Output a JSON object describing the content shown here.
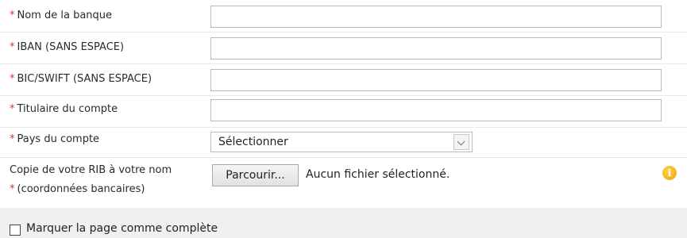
{
  "form": {
    "required_mark": "*",
    "fields": [
      {
        "label": "Nom de la banque",
        "value": ""
      },
      {
        "label": "IBAN (SANS ESPACE)",
        "value": ""
      },
      {
        "label": "BIC/SWIFT (SANS ESPACE)",
        "value": ""
      },
      {
        "label": "Titulaire du compte",
        "value": ""
      }
    ],
    "country": {
      "label": "Pays du compte",
      "selected": "Sélectionner"
    },
    "rib": {
      "label_line1": "Copie de votre RIB à votre nom",
      "label_line2": "(coordonnées bancaires)",
      "browse_label": "Parcourir...",
      "no_file_text": "Aucun fichier sélectionné.",
      "info_icon": "info-icon"
    }
  },
  "footer": {
    "checkbox_label": "Marquer la page comme complète",
    "checked": false
  }
}
